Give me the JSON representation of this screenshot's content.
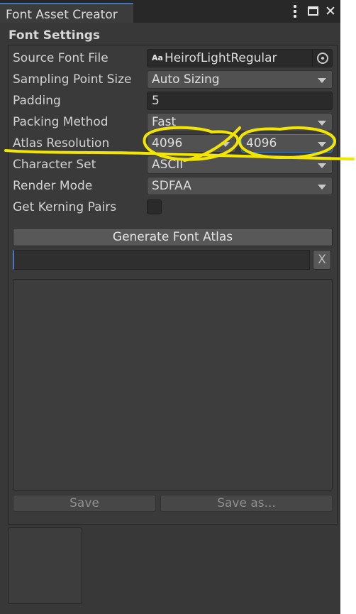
{
  "window": {
    "tab_title": "Font Asset Creator",
    "controls": [
      "kebab-menu-icon",
      "maximize-icon",
      "close-icon"
    ]
  },
  "section": {
    "title": "Font Settings"
  },
  "settings": {
    "source_font_file": {
      "label": "Source Font File",
      "value": "HeirofLightRegular",
      "icon_text": "Aa"
    },
    "sampling_point_size": {
      "label": "Sampling Point Size",
      "value": "Auto Sizing"
    },
    "padding": {
      "label": "Padding",
      "value": "5"
    },
    "packing_method": {
      "label": "Packing Method",
      "value": "Fast"
    },
    "atlas_resolution": {
      "label": "Atlas Resolution",
      "width": "4096",
      "height": "4096"
    },
    "character_set": {
      "label": "Character Set",
      "value": "ASCII"
    },
    "render_mode": {
      "label": "Render Mode",
      "value": "SDFAA"
    },
    "get_kerning_pairs": {
      "label": "Get Kerning Pairs",
      "checked": false
    }
  },
  "actions": {
    "generate": "Generate Font Atlas",
    "cancel": "X",
    "save": "Save",
    "save_as": "Save as..."
  },
  "annotation_color": "#f2e600",
  "colors": {
    "background": "#383838",
    "field": "#2a2a2a",
    "dropdown": "#515151",
    "accent": "#3a79bb"
  }
}
